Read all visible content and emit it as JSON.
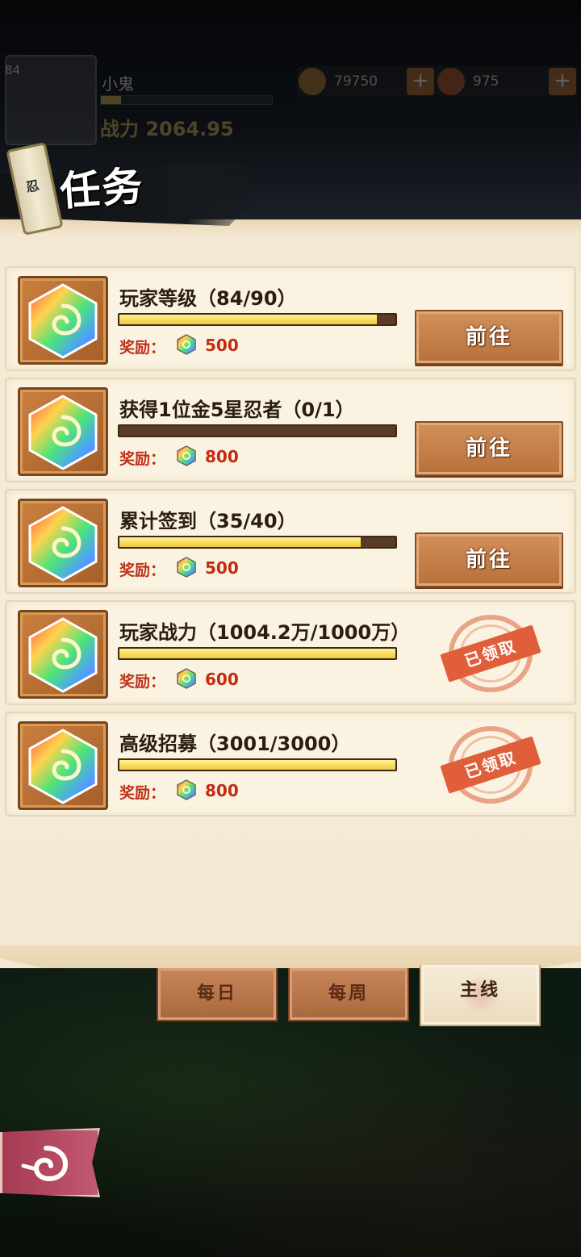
{
  "player": {
    "level": "84",
    "name": "小鬼",
    "power": "战力 2064.95",
    "exp_progress": 0.12
  },
  "currencies": [
    {
      "icon": "coin-icon",
      "value": "79750",
      "plus": "+"
    },
    {
      "icon": "gem-icon",
      "value": "975",
      "plus": "+"
    }
  ],
  "header": {
    "scroll_char": "忍",
    "title": "任务"
  },
  "reward_label": "奖励：",
  "tasks": [
    {
      "title": "玩家等级（84/90）",
      "progress": 0.933,
      "reward": "500",
      "status": "go",
      "button": "前往"
    },
    {
      "title": "获得1位金5星忍者（0/1）",
      "progress": 0.0,
      "reward": "800",
      "status": "go",
      "button": "前往"
    },
    {
      "title": "累计签到（35/40）",
      "progress": 0.875,
      "reward": "500",
      "status": "go",
      "button": "前往"
    },
    {
      "title": "玩家战力（1004.2万/1000万）",
      "progress": 1.0,
      "reward": "600",
      "status": "claimed",
      "stamp": "已领取"
    },
    {
      "title": "高级招募（3001/3000）",
      "progress": 1.0,
      "reward": "800",
      "status": "claimed",
      "stamp": "已领取"
    }
  ],
  "tabs": [
    {
      "label": "每日",
      "active": false
    },
    {
      "label": "每周",
      "active": false
    },
    {
      "label": "主线",
      "active": true
    }
  ],
  "colors": {
    "panel": "#f4e8d2",
    "progress_fill": "#f1c93c",
    "progress_track": "#5a3b24",
    "button": "#b8703b",
    "reward_text": "#c52a12",
    "stamp": "#e05e3a"
  }
}
